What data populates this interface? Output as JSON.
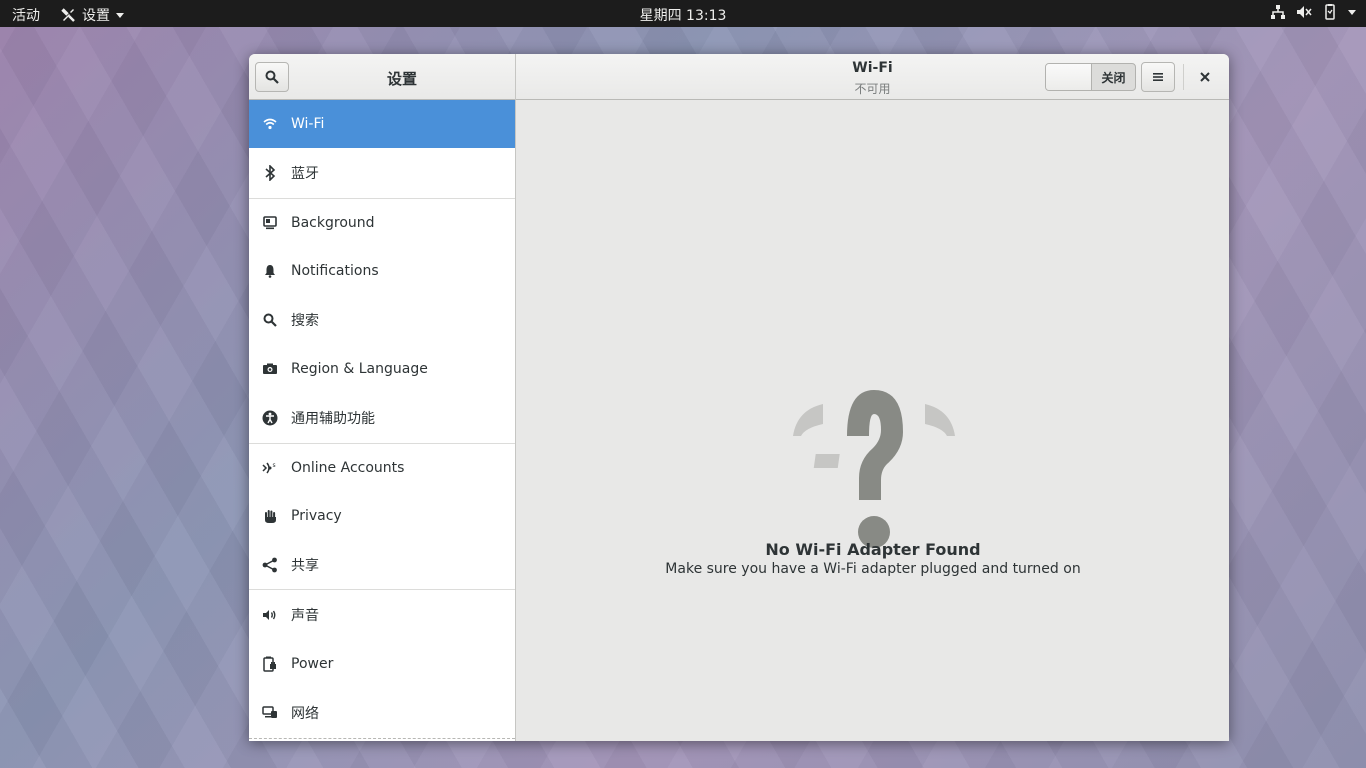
{
  "topbar": {
    "activities": "活动",
    "app_menu": "设置",
    "clock": "星期四 13:13",
    "tray_icons": [
      "network-icon",
      "volume-muted-icon",
      "battery-icon",
      "system-menu-arrow"
    ]
  },
  "window": {
    "sidebar_title": "设置",
    "panel_title": "Wi-Fi",
    "panel_subtitle": "不可用",
    "switch_label": "关闭",
    "switch_state": "off"
  },
  "sidebar": {
    "items": [
      {
        "label": "Wi-Fi",
        "icon": "wifi-icon",
        "active": true
      },
      {
        "label": "蓝牙",
        "icon": "bluetooth-icon"
      },
      {
        "label": "Background",
        "icon": "background-icon"
      },
      {
        "label": "Notifications",
        "icon": "bell-icon"
      },
      {
        "label": "搜索",
        "icon": "search-icon"
      },
      {
        "label": "Region & Language",
        "icon": "camera-icon"
      },
      {
        "label": "通用辅助功能",
        "icon": "accessibility-icon"
      },
      {
        "label": "Online Accounts",
        "icon": "online-accounts-icon"
      },
      {
        "label": "Privacy",
        "icon": "hand-icon"
      },
      {
        "label": "共享",
        "icon": "share-icon"
      },
      {
        "label": "声音",
        "icon": "speaker-icon"
      },
      {
        "label": "Power",
        "icon": "power-icon"
      },
      {
        "label": "网络",
        "icon": "network-icon"
      }
    ]
  },
  "empty_state": {
    "title": "No Wi-Fi Adapter Found",
    "description": "Make sure you have a Wi-Fi adapter plugged and turned on",
    "icon": "question-mark-wifi-icon"
  },
  "colors": {
    "accent": "#4a90d9",
    "topbar": "#1c1c1c",
    "text": "#2e3436"
  }
}
